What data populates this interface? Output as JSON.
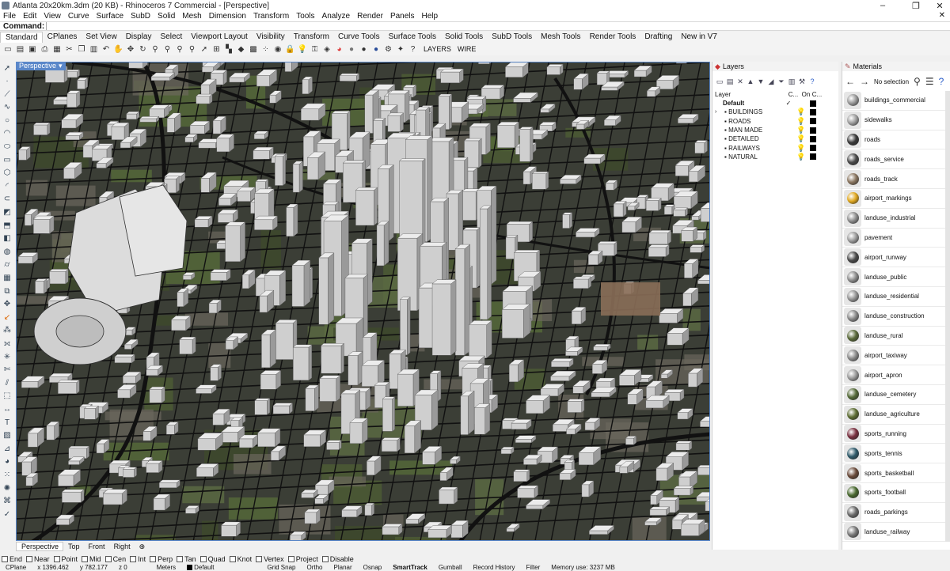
{
  "window": {
    "title": "Atlanta 20x20km.3dm (20 KB) - Rhinoceros 7 Commercial - [Perspective]",
    "controls": [
      "–",
      "❐",
      "✕"
    ]
  },
  "menu": [
    "File",
    "Edit",
    "View",
    "Curve",
    "Surface",
    "SubD",
    "Solid",
    "Mesh",
    "Dimension",
    "Transform",
    "Tools",
    "Analyze",
    "Render",
    "Panels",
    "Help"
  ],
  "command": {
    "label": "Command:",
    "value": ""
  },
  "toolbar_tabs": [
    "Standard",
    "CPlanes",
    "Set View",
    "Display",
    "Select",
    "Viewport Layout",
    "Visibility",
    "Transform",
    "Curve Tools",
    "Surface Tools",
    "Solid Tools",
    "SubD Tools",
    "Mesh Tools",
    "Render Tools",
    "Drafting",
    "New in V7"
  ],
  "toolbar_text": {
    "layers": "LAYERS",
    "wire": "WIRE"
  },
  "viewport": {
    "title": "Perspective"
  },
  "view_tabs": [
    "Perspective",
    "Top",
    "Front",
    "Right"
  ],
  "osnaps": [
    {
      "label": "End",
      "checked": false
    },
    {
      "label": "Near",
      "checked": false
    },
    {
      "label": "Point",
      "checked": false
    },
    {
      "label": "Mid",
      "checked": false
    },
    {
      "label": "Cen",
      "checked": false
    },
    {
      "label": "Int",
      "checked": false
    },
    {
      "label": "Perp",
      "checked": false
    },
    {
      "label": "Tan",
      "checked": false
    },
    {
      "label": "Quad",
      "checked": false
    },
    {
      "label": "Knot",
      "checked": false
    },
    {
      "label": "Vertex",
      "checked": false
    },
    {
      "label": "Project",
      "checked": false
    },
    {
      "label": "Disable",
      "checked": false
    }
  ],
  "status": {
    "cplane": "CPlane",
    "x": "x 1396.462",
    "y": "y 782.177",
    "z": "z 0",
    "units": "Meters",
    "layer": "Default",
    "items": [
      "Grid Snap",
      "Ortho",
      "Planar",
      "Osnap",
      "SmartTrack",
      "Gumball",
      "Record History",
      "Filter",
      "Memory use: 3237 MB"
    ]
  },
  "layers": {
    "title": "Layers",
    "headers": {
      "name": "Layer",
      "current": "C...",
      "on": "On",
      "color": "C..."
    },
    "rows": [
      {
        "name": "Default",
        "current": "✓",
        "on": "",
        "color": "#000000"
      },
      {
        "name": "BUILDINGS",
        "current": "",
        "on": "💡",
        "color": "#000000"
      },
      {
        "name": "ROADS",
        "current": "",
        "on": "💡",
        "color": "#000000"
      },
      {
        "name": "MAN MADE",
        "current": "",
        "on": "💡",
        "color": "#000000"
      },
      {
        "name": "DETAILED",
        "current": "",
        "on": "💡",
        "color": "#000000"
      },
      {
        "name": "RAILWAYS",
        "current": "",
        "on": "💡",
        "color": "#000000"
      },
      {
        "name": "NATURAL",
        "current": "",
        "on": "💡",
        "color": "#000000"
      }
    ]
  },
  "materials": {
    "title": "Materials",
    "selection": "No selection",
    "items": [
      {
        "name": "buildings_commercial",
        "color": "#9a9a9a"
      },
      {
        "name": "sidewalks",
        "color": "#a0a0a0"
      },
      {
        "name": "roads",
        "color": "#3a3a3a"
      },
      {
        "name": "roads_service",
        "color": "#4a4a4a"
      },
      {
        "name": "roads_track",
        "color": "#8a7660"
      },
      {
        "name": "airport_markings",
        "color": "#e0a820"
      },
      {
        "name": "landuse_industrial",
        "color": "#8e8e8e"
      },
      {
        "name": "pavement",
        "color": "#9c9c9c"
      },
      {
        "name": "airport_runway",
        "color": "#4a4a4a"
      },
      {
        "name": "landuse_public",
        "color": "#8c8c8c"
      },
      {
        "name": "landuse_residential",
        "color": "#949494"
      },
      {
        "name": "landuse_construction",
        "color": "#8a8a8a"
      },
      {
        "name": "landuse_rural",
        "color": "#5a6a3a"
      },
      {
        "name": "airport_taxiway",
        "color": "#8a8a8a"
      },
      {
        "name": "airport_apron",
        "color": "#9a9a9a"
      },
      {
        "name": "landuse_cemetery",
        "color": "#556a38"
      },
      {
        "name": "landuse_agriculture",
        "color": "#5e6e34"
      },
      {
        "name": "sports_running",
        "color": "#7a3040"
      },
      {
        "name": "sports_tennis",
        "color": "#2e5a6a"
      },
      {
        "name": "sports_basketball",
        "color": "#6a4a3a"
      },
      {
        "name": "sports_football",
        "color": "#4a6a30"
      },
      {
        "name": "roads_parkings",
        "color": "#6a6a6a"
      },
      {
        "name": "landuse_railway",
        "color": "#7a7a7a"
      }
    ]
  },
  "colors": {
    "accent": "#5a87c9",
    "panel_bg": "#ffffff",
    "chrome_bg": "#f0f0f0"
  }
}
